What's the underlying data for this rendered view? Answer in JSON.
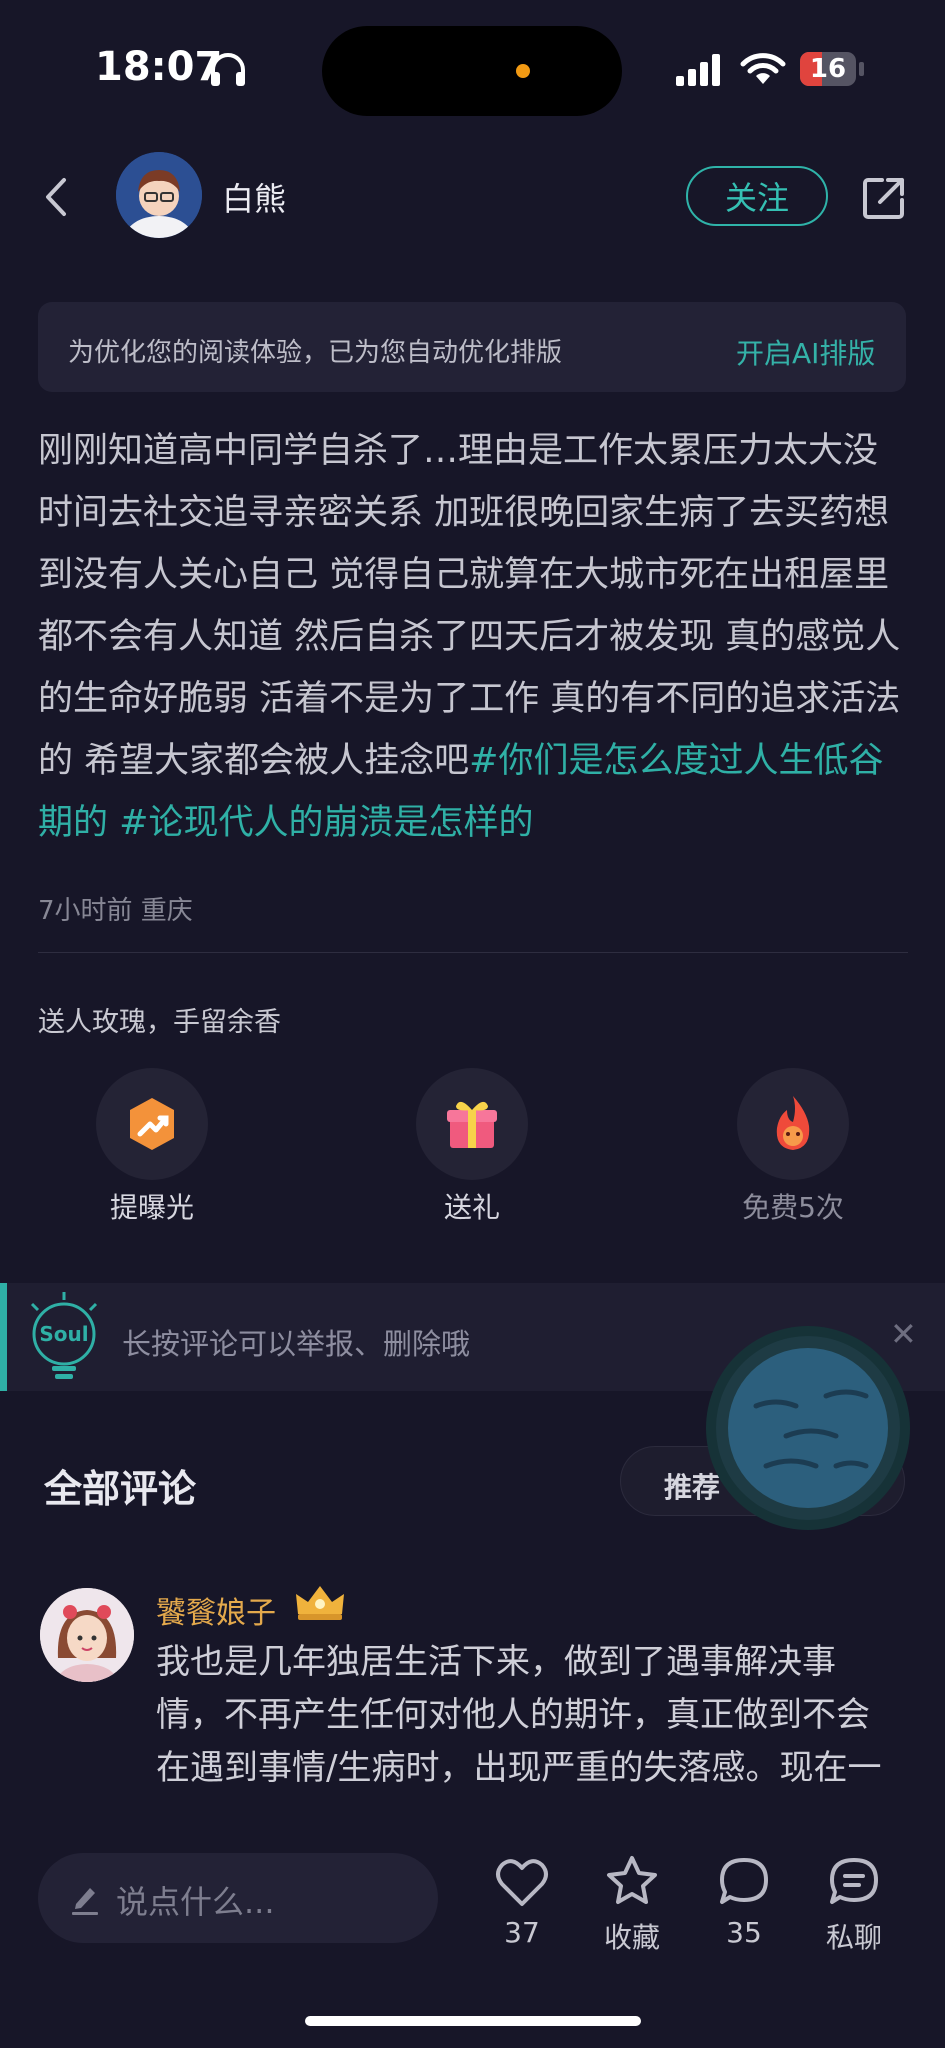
{
  "status_bar": {
    "time": "18:07",
    "battery": "16"
  },
  "header": {
    "username": "白熊",
    "follow_label": "关注"
  },
  "notice": {
    "text": "为优化您的阅读体验，已为您自动优化排版",
    "link": "开启AI排版"
  },
  "post": {
    "body": "刚刚知道高中同学自杀了…理由是工作太累压力太大没时间去社交追寻亲密关系 加班很晚回家生病了去买药想到没有人关心自己 觉得自己就算在大城市死在出租屋里都不会有人知道 然后自杀了四天后才被发现 真的感觉人的生命好脆弱 活着不是为了工作 真的有不同的追求活法的 希望大家都会被人挂念吧",
    "tags": [
      "#你们是怎么度过人生低谷期的",
      "#论现代人的崩溃是怎样的"
    ],
    "meta": "7小时前 重庆"
  },
  "gifts": {
    "title": "送人玫瑰，手留余香",
    "actions": [
      {
        "label": "提曝光",
        "icon": "boost-icon"
      },
      {
        "label": "送礼",
        "icon": "gift-icon"
      },
      {
        "label": "免费5次",
        "icon": "fire-icon"
      }
    ]
  },
  "tip": {
    "logo": "Soul",
    "text": "长按评论可以举报、删除哦"
  },
  "comments": {
    "title": "全部评论",
    "sort_label": "推荐",
    "items": [
      {
        "name": "饕餮娘子",
        "text": "我也是几年独居生活下来，做到了遇事解决事情，不再产生任何对他人的期许，真正做到不会在遇到事情/生病时，出现严重的失落感。现在一个人住院、挂急诊、出行生病等等，都是"
      }
    ]
  },
  "bottom_bar": {
    "input_placeholder": "说点什么...",
    "likes": "37",
    "favorite_label": "收藏",
    "comments": "35",
    "message_label": "私聊"
  },
  "colors": {
    "accent": "#2fb0a6",
    "background": "#171628",
    "name": "#e4a94c"
  }
}
